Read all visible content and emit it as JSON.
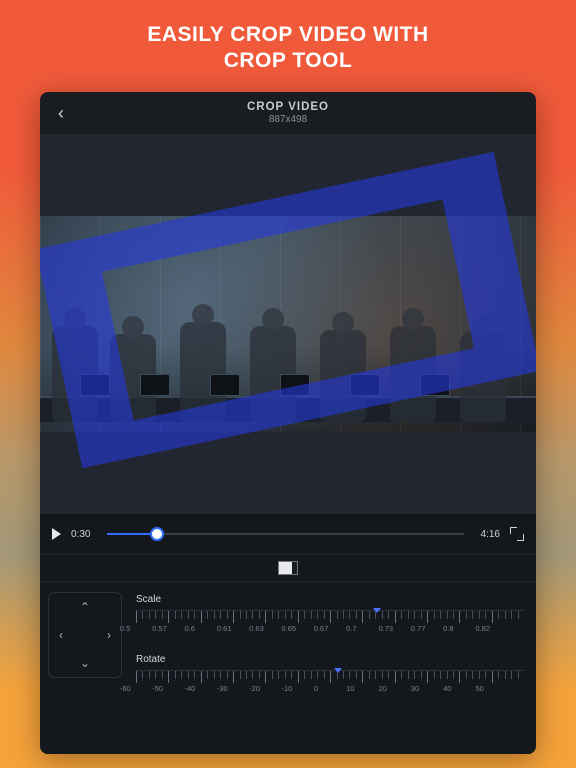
{
  "hero": {
    "line1": "EASILY CROP VIDEO WITH",
    "line2": "CROP TOOL"
  },
  "topbar": {
    "title": "CROP VIDEO",
    "dimensions": "887x498"
  },
  "playback": {
    "current_time": "0:30",
    "total_time": "4:16",
    "progress_pct": 14
  },
  "dpad": {
    "up": "⌃",
    "down": "⌄",
    "left": "‹",
    "right": "›"
  },
  "scale": {
    "label": "Scale",
    "ticks": [
      "0.5",
      "0.57",
      "0.6",
      "0.61",
      "0.63",
      "0.65",
      "0.67",
      "0.7",
      "0.73",
      "0.77",
      "0.8",
      "0.82"
    ],
    "marker_pct": 62
  },
  "rotate": {
    "label": "Rotate",
    "ticks": [
      "-60",
      "-50",
      "-40",
      "-30",
      "-20",
      "-10",
      "0",
      "10",
      "20",
      "30",
      "40",
      "50"
    ],
    "marker_pct": 52
  }
}
